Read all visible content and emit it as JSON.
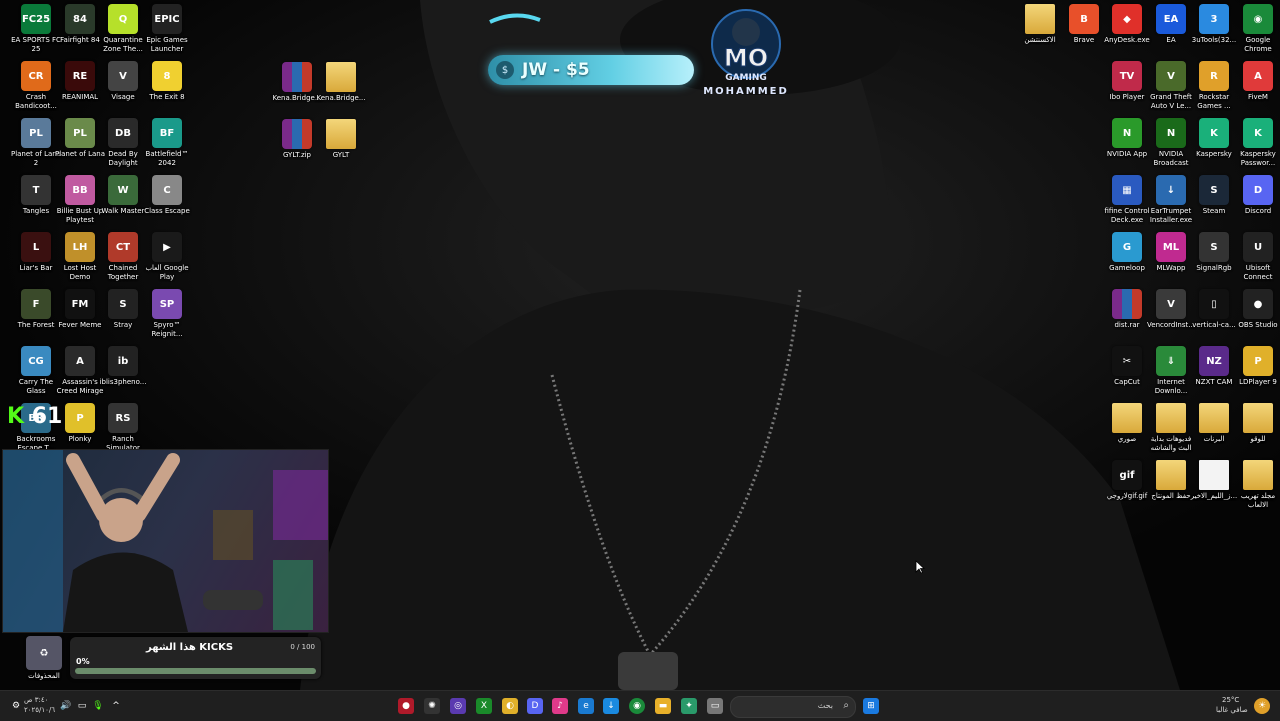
{
  "donation": {
    "text": "JW - $5",
    "coin_symbol": "$"
  },
  "logo": {
    "line1": "MO",
    "line2": "GAMING",
    "line3": "MOHAMMED"
  },
  "kick_badge": {
    "letter": "K",
    "count": "61"
  },
  "goal": {
    "title": "هذا الشهر KICKS",
    "count": "0 / 100",
    "percent_text": "0%",
    "progress": 0
  },
  "desktop_left": [
    {
      "label": "EA SPORTS FC 25",
      "color": "#0a7a3a",
      "glyph": "FC25"
    },
    {
      "label": "Fairfight 84",
      "color": "#2a3a2a",
      "glyph": "84"
    },
    {
      "label": "Quarantine Zone The...",
      "color": "#b6e02a",
      "glyph": "Q"
    },
    {
      "label": "Epic Games Launcher",
      "color": "#222222",
      "glyph": "EPIC"
    },
    {
      "label": "Crash Bandicoot...",
      "color": "#e06a1a",
      "glyph": "CR"
    },
    {
      "label": "REANIMAL",
      "color": "#3a0a0a",
      "glyph": "RE"
    },
    {
      "label": "Visage",
      "color": "#444444",
      "glyph": "V"
    },
    {
      "label": "The Exit 8",
      "color": "#f0d030",
      "glyph": "8"
    },
    {
      "label": "Planet of Lana 2",
      "color": "#5a7a9a",
      "glyph": "PL"
    },
    {
      "label": "Planet of Lana",
      "color": "#6a8a4a",
      "glyph": "PL"
    },
    {
      "label": "Dead By Daylight",
      "color": "#2a2a2a",
      "glyph": "DB"
    },
    {
      "label": "Battlefield™ 2042",
      "color": "#1a9a8a",
      "glyph": "BF"
    },
    {
      "label": "Tangles",
      "color": "#333333",
      "glyph": "T"
    },
    {
      "label": "Billie Bust Up Playtest",
      "color": "#c05aa0",
      "glyph": "BB"
    },
    {
      "label": "Walk Master",
      "color": "#3a6a3a",
      "glyph": "W"
    },
    {
      "label": "Class Escape",
      "color": "#888888",
      "glyph": "C"
    },
    {
      "label": "Liar's Bar",
      "color": "#3a1010",
      "glyph": "L"
    },
    {
      "label": "Lost Host Demo",
      "color": "#c0902a",
      "glyph": "LH"
    },
    {
      "label": "Chained Together",
      "color": "#b03a2a",
      "glyph": "CT"
    },
    {
      "label": "ألعاب Google Play",
      "color": "#1a1a1a",
      "glyph": "▶"
    },
    {
      "label": "The Forest",
      "color": "#3a4a2a",
      "glyph": "F"
    },
    {
      "label": "Fever Meme",
      "color": "#111111",
      "glyph": "FM"
    },
    {
      "label": "Stray",
      "color": "#222222",
      "glyph": "S"
    },
    {
      "label": "Spyro™ Reignit...",
      "color": "#7a4ab0",
      "glyph": "SP"
    },
    {
      "label": "Carry The Glass",
      "color": "#3a8ac0",
      "glyph": "CG"
    },
    {
      "label": "Assassin's Creed Mirage",
      "color": "#2a2a2a",
      "glyph": "A"
    },
    {
      "label": "iblis3pheno...",
      "color": "#222222",
      "glyph": "ib"
    },
    {
      "label": "",
      "color": "transparent",
      "glyph": ""
    },
    {
      "label": "Backrooms Escape T...",
      "color": "#2a6a8a",
      "glyph": "BR"
    },
    {
      "label": "Plonky",
      "color": "#e0c02a",
      "glyph": "P"
    },
    {
      "label": "Ranch Simulator",
      "color": "#333333",
      "glyph": "RS"
    }
  ],
  "desktop_files": [
    {
      "label": "Kena.Bridge...",
      "type": "rar"
    },
    {
      "label": "Kena.Bridge...",
      "type": "folder"
    },
    {
      "label": "GYLT.zip",
      "type": "rar"
    },
    {
      "label": "GYLT",
      "type": "folder"
    }
  ],
  "desktop_right": [
    [
      {
        "label": "الاكسنتشن",
        "color": "#e8c25a",
        "glyph": "",
        "type": "folder"
      },
      {
        "label": "Brave",
        "color": "#e8502a",
        "glyph": "B"
      },
      {
        "label": "AnyDesk.exe",
        "color": "#e0302a",
        "glyph": "◆"
      },
      {
        "label": "EA",
        "color": "#1a5adb",
        "glyph": "EA"
      },
      {
        "label": "3uTools(32...",
        "color": "#2a8ae0",
        "glyph": "3"
      },
      {
        "label": "Google Chrome",
        "color": "#1a8a3a",
        "glyph": "◉"
      }
    ],
    [
      {
        "label": "Ibo Player",
        "color": "#c02a4a",
        "glyph": "TV"
      },
      {
        "label": "Grand Theft Auto V Le...",
        "color": "#4a6a2a",
        "glyph": "V"
      },
      {
        "label": "Rockstar Games ...",
        "color": "#e0a02a",
        "glyph": "R"
      },
      {
        "label": "FiveM",
        "color": "#e03a3a",
        "glyph": "A"
      }
    ],
    [
      {
        "label": "NVIDIA App",
        "color": "#2a9a2a",
        "glyph": "N"
      },
      {
        "label": "NVIDIA Broadcast",
        "color": "#1a6a1a",
        "glyph": "N"
      },
      {
        "label": "Kaspersky",
        "color": "#1ab07a",
        "glyph": "K"
      },
      {
        "label": "Kaspersky Passwor...",
        "color": "#1ab07a",
        "glyph": "K"
      }
    ],
    [
      {
        "label": "fifine Control Deck.exe",
        "color": "#2a5ac0",
        "glyph": "▦"
      },
      {
        "label": "EarTrumpet Installer.exe",
        "color": "#2a6ab0",
        "glyph": "↓"
      },
      {
        "label": "Steam",
        "color": "#1b2838",
        "glyph": "S"
      },
      {
        "label": "Discord",
        "color": "#5865f2",
        "glyph": "D"
      }
    ],
    [
      {
        "label": "Gameloop",
        "color": "#2a9ad0",
        "glyph": "G"
      },
      {
        "label": "MLWapp",
        "color": "#c02a90",
        "glyph": "ML"
      },
      {
        "label": "SignalRgb",
        "color": "#333333",
        "glyph": "S"
      },
      {
        "label": "Ubisoft Connect",
        "color": "#222222",
        "glyph": "U"
      }
    ],
    [
      {
        "label": "dist.rar",
        "color": "#7a2a8a",
        "glyph": "",
        "type": "rar"
      },
      {
        "label": "VencordInst...",
        "color": "#3a3a3a",
        "glyph": "V"
      },
      {
        "label": "vertical-ca...",
        "color": "#111111",
        "glyph": "▯"
      },
      {
        "label": "OBS Studio",
        "color": "#222222",
        "glyph": "●"
      }
    ],
    [
      {
        "label": "CapCut",
        "color": "#111111",
        "glyph": "✂"
      },
      {
        "label": "Internet Downlo...",
        "color": "#2a8a3a",
        "glyph": "⇓"
      },
      {
        "label": "NZXT CAM",
        "color": "#5a2a8a",
        "glyph": "NZ"
      },
      {
        "label": "LDPlayer 9",
        "color": "#e0b02a",
        "glyph": "P"
      }
    ],
    [
      {
        "label": "صوري",
        "color": "",
        "glyph": "",
        "type": "folder"
      },
      {
        "label": "فديوهات بداية البث والشاشه",
        "color": "",
        "glyph": "",
        "type": "folder"
      },
      {
        "label": "البرنات",
        "color": "",
        "glyph": "",
        "type": "folder"
      },
      {
        "label": "للوقو",
        "color": "",
        "glyph": "",
        "type": "folder"
      }
    ],
    [
      {
        "label": "لاروجيgif.gif",
        "color": "#111111",
        "glyph": "gif"
      },
      {
        "label": "حفظ المونتاج",
        "color": "",
        "glyph": "",
        "type": "folder"
      },
      {
        "label": "ز_الليم_الاخير...",
        "color": "",
        "glyph": "",
        "type": "doc"
      },
      {
        "label": "مجلد تهريب الالعاب",
        "color": "",
        "glyph": "",
        "type": "folder"
      }
    ]
  ],
  "recycle_bin": {
    "label": "المحذوفات"
  },
  "taskbar": {
    "search_placeholder": "بحث",
    "search_icon": "search-icon",
    "start_icon": "windows-start-icon",
    "weather_temp": "25°C",
    "weather_desc": "صافي غالبا",
    "time": "٣:٤٠ ص",
    "date": "٢٠٢٥/١٠/٦"
  },
  "colors": {
    "kick_green": "#53fc18",
    "taskbar_bg": "#1f1f1f",
    "donation_cyan": "#62cfe4"
  }
}
